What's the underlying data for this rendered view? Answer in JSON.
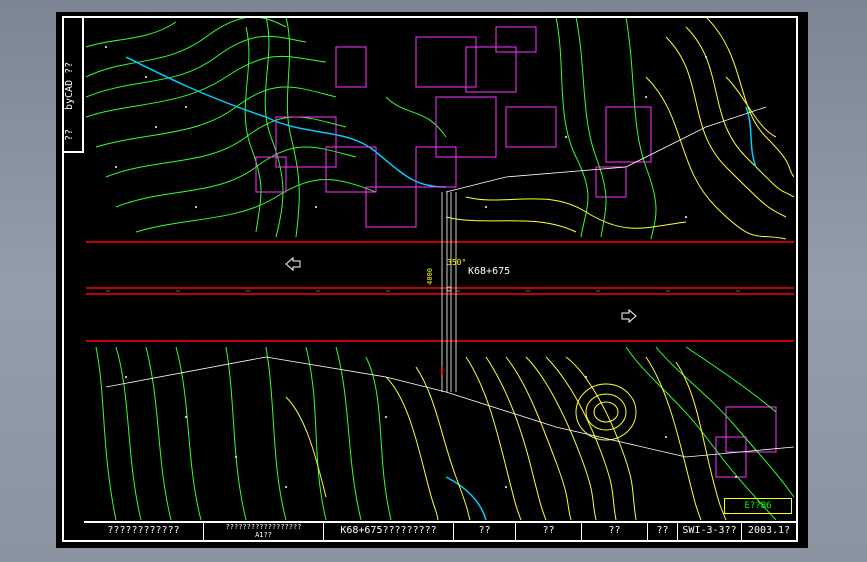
{
  "sidebar": {
    "top_label": "??",
    "product_label": "byCAD ??"
  },
  "drawing": {
    "station_label": "K68+675",
    "angle_label": "350°",
    "distance_label": "4000",
    "legend_label": "E??B6"
  },
  "title_block": {
    "cells": [
      {
        "text": "????????????"
      },
      {
        "text": "??????????????????",
        "sub": "A1??"
      },
      {
        "text": "K68+675?????????"
      },
      {
        "text": "??"
      },
      {
        "text": "??"
      },
      {
        "text": "??"
      },
      {
        "text": "??"
      },
      {
        "text": "SWI-3-3??"
      },
      {
        "text": "2003.1?"
      }
    ]
  },
  "colors": {
    "background": "#000000",
    "road_edge": "#ff0000",
    "contour_green": "#33ff33",
    "contour_yellow": "#ffff33",
    "building": "#ff33ff",
    "water": "#00ccff"
  }
}
